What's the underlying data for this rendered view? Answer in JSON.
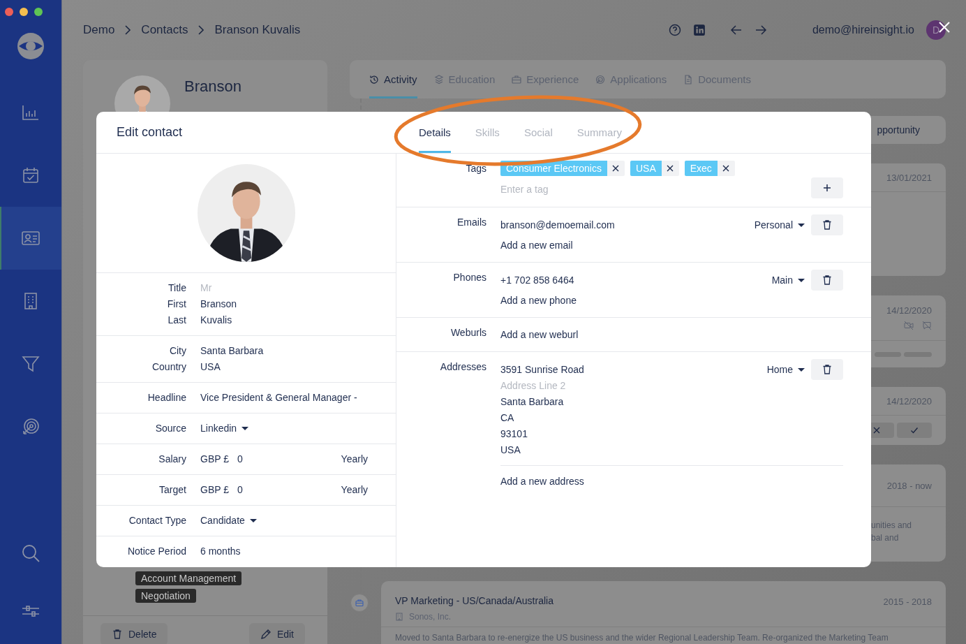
{
  "sidebar": {
    "items": [
      {
        "selected": false
      },
      {
        "selected": false
      },
      {
        "selected": true
      },
      {
        "selected": false
      },
      {
        "selected": false
      },
      {
        "selected": false
      }
    ]
  },
  "breadcrumb": [
    "Demo",
    "Contacts",
    "Branson Kuvalis"
  ],
  "header": {
    "user_email": "demo@hireinsight.io",
    "avatar_initial": "D"
  },
  "profile": {
    "name_lines": [
      "Branson"
    ],
    "skills": [
      "Account Management",
      "Negotiation"
    ],
    "actions": [
      "Delete",
      "Edit"
    ]
  },
  "profile_tabs": [
    {
      "label": "Activity",
      "selected": true
    },
    {
      "label": "Education",
      "selected": false
    },
    {
      "label": "Experience",
      "selected": false
    },
    {
      "label": "Applications",
      "selected": false
    },
    {
      "label": "Documents",
      "selected": false
    }
  ],
  "activity_cards": [
    {
      "kind": "label",
      "title": "pportunity"
    },
    {
      "kind": "dated",
      "date": "13/01/2021"
    },
    {
      "kind": "call",
      "date": "14/12/2020"
    },
    {
      "kind": "task",
      "date": "14/12/2020"
    },
    {
      "kind": "job",
      "date": "2018 - now",
      "description_lines": [
        "unities and",
        "bal and"
      ]
    },
    {
      "kind": "job",
      "title": "VP Marketing - US/Canada/Australia",
      "company": "Sonos, Inc.",
      "date": "2015 - 2018",
      "description_lines": [
        "Moved to Santa Barbara to re-energize the US business and the wider Regional Leadership Team. Re-organized the Marketing Team"
      ]
    }
  ],
  "modal": {
    "title": "Edit contact",
    "tabs": [
      {
        "label": "Details",
        "selected": true
      },
      {
        "label": "Skills",
        "selected": false
      },
      {
        "label": "Social",
        "selected": false
      },
      {
        "label": "Summary",
        "selected": false
      }
    ],
    "field_groups": [
      {
        "rows": [
          {
            "kind": "text",
            "label": "Title",
            "placeholder": "Mr"
          },
          {
            "kind": "text",
            "label": "First",
            "value": "Branson"
          },
          {
            "kind": "text",
            "label": "Last",
            "value": "Kuvalis"
          }
        ]
      },
      {
        "rows": [
          {
            "kind": "text",
            "label": "City",
            "value": "Santa Barbara"
          },
          {
            "kind": "text",
            "label": "Country",
            "value": "USA"
          }
        ]
      },
      {
        "rows": [
          {
            "kind": "text",
            "label": "Headline",
            "value": "Vice President & General Manager -"
          }
        ]
      },
      {
        "rows": [
          {
            "kind": "dropdown",
            "label": "Source",
            "value": "Linkedin"
          }
        ]
      },
      {
        "rows": [
          {
            "kind": "money",
            "label": "Salary",
            "currency": "GBP £",
            "value": "0",
            "period": "Yearly"
          }
        ]
      },
      {
        "rows": [
          {
            "kind": "money",
            "label": "Target",
            "currency": "GBP £",
            "value": "0",
            "period": "Yearly"
          }
        ]
      },
      {
        "rows": [
          {
            "kind": "dropdown",
            "label": "Contact Type",
            "value": "Candidate"
          }
        ]
      },
      {
        "rows": [
          {
            "kind": "text",
            "label": "Notice Period",
            "value": "6 months"
          }
        ]
      }
    ],
    "tags": {
      "label": "Tags",
      "items": [
        "Consumer Electronics",
        "USA",
        "Exec"
      ],
      "placeholder": "Enter a tag"
    },
    "sections": [
      {
        "label": "Emails",
        "entries": [
          {
            "lines": [
              {
                "value": "branson@demoemail.com"
              }
            ],
            "type": "Personal"
          }
        ],
        "add": "Add a new email",
        "divided": false
      },
      {
        "label": "Phones",
        "entries": [
          {
            "lines": [
              {
                "value": "+1 702 858 6464"
              }
            ],
            "type": "Main"
          }
        ],
        "add": "Add a new phone",
        "divided": false
      },
      {
        "label": "Weburls",
        "add": "Add a new weburl",
        "divided": false
      },
      {
        "label": "Addresses",
        "entries": [
          {
            "lines": [
              {
                "value": "3591 Sunrise Road"
              },
              {
                "placeholder": "Address Line 2"
              },
              {
                "value": "Santa Barbara"
              },
              {
                "value": "CA"
              },
              {
                "value": "93101"
              },
              {
                "value": "USA"
              }
            ],
            "type": "Home"
          }
        ],
        "add": "Add a new address",
        "divided": true
      }
    ]
  }
}
